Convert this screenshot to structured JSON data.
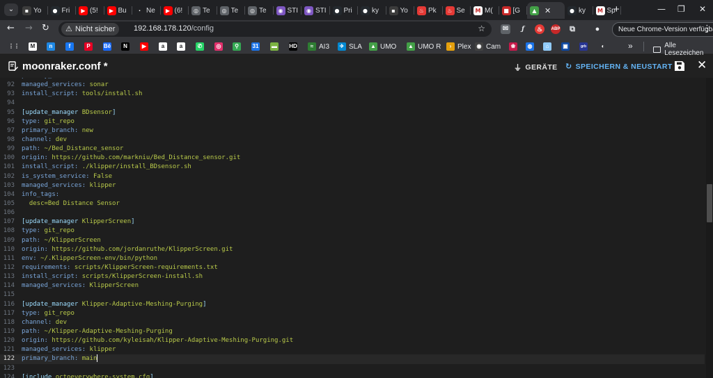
{
  "browser": {
    "tabs": [
      {
        "label": "Yo",
        "icon": "yt-channel-icon",
        "color": "#3c3c3c",
        "glyph": "▪"
      },
      {
        "label": "Fri",
        "icon": "github-icon",
        "color": "#24292e",
        "glyph": "●"
      },
      {
        "label": "(5!",
        "icon": "youtube-icon",
        "color": "#ff0000",
        "glyph": "▶"
      },
      {
        "label": "Bu",
        "icon": "youtube-icon",
        "color": "#ff0000",
        "glyph": "▶"
      },
      {
        "label": "Ne",
        "icon": "dark-icon",
        "color": "#202124",
        "glyph": "·"
      },
      {
        "label": "(6!",
        "icon": "youtube-icon",
        "color": "#ff0000",
        "glyph": "▶"
      },
      {
        "label": "Te",
        "icon": "globe-icon",
        "color": "#5f6368",
        "glyph": "◎"
      },
      {
        "label": "Te",
        "icon": "globe-icon",
        "color": "#5f6368",
        "glyph": "◎"
      },
      {
        "label": "Te",
        "icon": "globe-icon",
        "color": "#5f6368",
        "glyph": "◎"
      },
      {
        "label": "STI",
        "icon": "purple-icon",
        "color": "#7e57c2",
        "glyph": "◉"
      },
      {
        "label": "STI",
        "icon": "purple-icon",
        "color": "#7e57c2",
        "glyph": "◉"
      },
      {
        "label": "Pri",
        "icon": "github-icon",
        "color": "#24292e",
        "glyph": "●"
      },
      {
        "label": "ky",
        "icon": "github-icon",
        "color": "#24292e",
        "glyph": "●"
      },
      {
        "label": "Yo",
        "icon": "yt-channel-icon",
        "color": "#3c3c3c",
        "glyph": "▪"
      },
      {
        "label": "Pk",
        "icon": "flame-icon",
        "color": "#e53935",
        "glyph": "♨"
      },
      {
        "label": "Se",
        "icon": "flame-icon",
        "color": "#e53935",
        "glyph": "♨"
      },
      {
        "label": "M(",
        "icon": "m-icon",
        "color": "#ffffff",
        "glyph": "M"
      },
      {
        "label": "[G",
        "icon": "red-square-icon",
        "color": "#c62828",
        "glyph": "■"
      },
      {
        "label": "",
        "icon": "mainsail-icon",
        "color": "#43a047",
        "glyph": "▲",
        "active": true
      },
      {
        "label": "ky",
        "icon": "github-icon",
        "color": "#24292e",
        "glyph": "●"
      },
      {
        "label": "Sp",
        "icon": "gmail-icon",
        "color": "#ffffff",
        "glyph": "M"
      }
    ],
    "active_tab_close": "✕",
    "new_tab": "+",
    "window_controls": {
      "minimize": "—",
      "maximize": "❐",
      "close": "✕"
    },
    "site_info": "Nicht sicher",
    "url_host": "192.168.178.120",
    "url_path": "/config",
    "update_button": "Neue Chrome-Version verfügbar",
    "bookmarks": [
      {
        "label": "",
        "icon": "apps-icon",
        "color": "#35363a",
        "glyph": "⋮⋮"
      },
      {
        "label": "",
        "icon": "gmail-icon",
        "color": "#ffffff",
        "glyph": "M"
      },
      {
        "label": "",
        "icon": "n-icon",
        "color": "#1e88e5",
        "glyph": "n"
      },
      {
        "label": "",
        "icon": "facebook-icon",
        "color": "#1877f2",
        "glyph": "f"
      },
      {
        "label": "",
        "icon": "pinterest-icon",
        "color": "#e60023",
        "glyph": "P"
      },
      {
        "label": "",
        "icon": "behance-icon",
        "color": "#1769ff",
        "glyph": "Bē"
      },
      {
        "label": "",
        "icon": "netflix-icon",
        "color": "#000000",
        "glyph": "N"
      },
      {
        "label": "",
        "icon": "youtube-icon",
        "color": "#ff0000",
        "glyph": "▶"
      },
      {
        "label": "",
        "icon": "amazon-icon",
        "color": "#ffffff",
        "glyph": "a"
      },
      {
        "label": "",
        "icon": "amazon-icon",
        "color": "#ffffff",
        "glyph": "a"
      },
      {
        "label": "",
        "icon": "whatsapp-icon",
        "color": "#25d366",
        "glyph": "✆"
      },
      {
        "label": "",
        "icon": "instagram-icon",
        "color": "#e1306c",
        "glyph": "◎"
      },
      {
        "label": "",
        "icon": "maps-icon",
        "color": "#34a853",
        "glyph": "⚲"
      },
      {
        "label": "",
        "icon": "calendar-icon",
        "color": "#1a73e8",
        "glyph": "31"
      },
      {
        "label": "",
        "icon": "green-bar-icon",
        "color": "#7cb342",
        "glyph": "▬"
      },
      {
        "label": "",
        "icon": "hd-icon",
        "color": "#000000",
        "glyph": "HD"
      },
      {
        "label": "AI3",
        "icon": "ai3-icon",
        "color": "#2e7d32",
        "glyph": "≈"
      },
      {
        "label": "SLA",
        "icon": "sla-icon",
        "color": "#0288d1",
        "glyph": "✈"
      },
      {
        "label": "UMO",
        "icon": "umo-icon",
        "color": "#43a047",
        "glyph": "▲"
      },
      {
        "label": "UMO R",
        "icon": "umo-icon",
        "color": "#43a047",
        "glyph": "▲"
      },
      {
        "label": "Plex",
        "icon": "plex-icon",
        "color": "#e5a00d",
        "glyph": "›"
      },
      {
        "label": "Cam",
        "icon": "camera-icon",
        "color": "#424242",
        "glyph": "◉"
      },
      {
        "label": "",
        "icon": "raspberry-icon",
        "color": "#c51a4a",
        "glyph": "❀"
      },
      {
        "label": "",
        "icon": "globe-icon",
        "color": "#1a73e8",
        "glyph": "◍"
      },
      {
        "label": "",
        "icon": "home-icon",
        "color": "#90caf9",
        "glyph": "⌂"
      },
      {
        "label": "",
        "icon": "cad-icon",
        "color": "#0d47a1",
        "glyph": "▣"
      },
      {
        "label": "",
        "icon": "grb-icon",
        "color": "#283593",
        "glyph": "grb"
      },
      {
        "label": "",
        "icon": "octoprint-icon",
        "color": "#35363a",
        "glyph": "◐"
      }
    ],
    "bookmarks_more": "»",
    "all_bookmarks": "Alle Lesezeichen"
  },
  "editor": {
    "file_title": "moonraker.conf *",
    "devices_label": "GERÄTE",
    "save_restart_label": "SPEICHERN & NEUSTART",
    "close": "✕",
    "current_line": 122,
    "lines": [
      {
        "n": "92",
        "t": "primary_branch: main"
      },
      {
        "n": "92",
        "t": "managed_services: sonar"
      },
      {
        "n": "93",
        "t": "install_script: tools/install.sh"
      },
      {
        "n": "94",
        "t": ""
      },
      {
        "n": "95",
        "t": "[update_manager BDsensor]"
      },
      {
        "n": "96",
        "t": "type: git_repo"
      },
      {
        "n": "97",
        "t": "primary_branch: new"
      },
      {
        "n": "98",
        "t": "channel: dev"
      },
      {
        "n": "99",
        "t": "path: ~/Bed_Distance_sensor"
      },
      {
        "n": "100",
        "t": "origin: https://github.com/markniu/Bed_Distance_sensor.git"
      },
      {
        "n": "101",
        "t": "install_script: ./klipper/install_BDsensor.sh"
      },
      {
        "n": "102",
        "t": "is_system_service: False"
      },
      {
        "n": "103",
        "t": "managed_services: klipper"
      },
      {
        "n": "104",
        "t": "info_tags:"
      },
      {
        "n": "105",
        "t": "  desc=Bed Distance Sensor"
      },
      {
        "n": "106",
        "t": ""
      },
      {
        "n": "107",
        "t": "[update_manager KlipperScreen]"
      },
      {
        "n": "108",
        "t": "type: git_repo"
      },
      {
        "n": "109",
        "t": "path: ~/KlipperScreen"
      },
      {
        "n": "110",
        "t": "origin: https://github.com/jordanruthe/KlipperScreen.git"
      },
      {
        "n": "111",
        "t": "env: ~/.KlipperScreen-env/bin/python"
      },
      {
        "n": "112",
        "t": "requirements: scripts/KlipperScreen-requirements.txt"
      },
      {
        "n": "113",
        "t": "install_script: scripts/KlipperScreen-install.sh"
      },
      {
        "n": "114",
        "t": "managed_services: KlipperScreen"
      },
      {
        "n": "115",
        "t": ""
      },
      {
        "n": "116",
        "t": "[update_manager Klipper-Adaptive-Meshing-Purging]"
      },
      {
        "n": "117",
        "t": "type: git_repo"
      },
      {
        "n": "118",
        "t": "channel: dev"
      },
      {
        "n": "119",
        "t": "path: ~/Klipper-Adaptive-Meshing-Purging"
      },
      {
        "n": "120",
        "t": "origin: https://github.com/kyleisah/Klipper-Adaptive-Meshing-Purging.git"
      },
      {
        "n": "121",
        "t": "managed_services: klipper"
      },
      {
        "n": "122",
        "t": "primary_branch: main"
      },
      {
        "n": "123",
        "t": ""
      },
      {
        "n": "124",
        "t": "[include octoeverywhere-system.cfg]"
      }
    ]
  },
  "colors": {
    "section": "#9cdcfe",
    "key": "#7aa6da",
    "value": "#b9ca4a",
    "accent": "#64b5f6"
  }
}
